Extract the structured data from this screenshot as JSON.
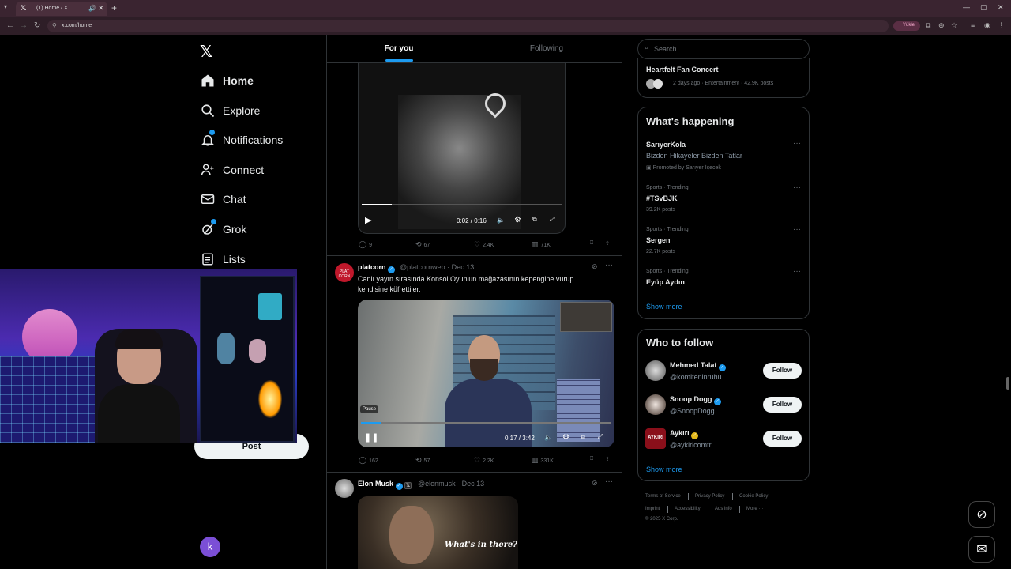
{
  "browser": {
    "tab_title": "(1) Home / X",
    "url": "x.com/home",
    "yukle": "Yükle"
  },
  "nav": {
    "home": "Home",
    "explore": "Explore",
    "notifications": "Notifications",
    "connect": "Connect",
    "chat": "Chat",
    "grok": "Grok",
    "lists": "Lists",
    "post": "Post",
    "account_initial": "k"
  },
  "tabs": {
    "for_you": "For you",
    "following": "Following"
  },
  "tweet1": {
    "video_time": "0:02 / 0:16",
    "video_progress": 0.15,
    "replies": "9",
    "reposts": "67",
    "likes": "2.4K",
    "views": "71K"
  },
  "tweet2": {
    "name": "platcorn",
    "handle": "@platcornweb",
    "date": "· Dec 13",
    "text": "Canlı yayın sırasında Konsol Oyun'un mağazasının kepengine vurup kendisine küfrettiler.",
    "pause_tip": "Pause",
    "video_time": "0:17 / 3:42",
    "video_progress": 0.08,
    "replies": "162",
    "reposts": "57",
    "likes": "2.2K",
    "views": "331K",
    "avatar_text": "PLAT CORN"
  },
  "tweet3": {
    "name": "Elon Musk",
    "handle": "@elonmusk",
    "date": "· Dec 13",
    "gif_caption": "What's in there?"
  },
  "right": {
    "search_placeholder": "Search",
    "top_event": {
      "title": "Heartfelt Fan Concert",
      "meta": "2 days ago · Entertainment · 42.9K posts"
    },
    "whats_happening": "What's happening",
    "promoted": {
      "title": "SarıyerKola",
      "subtitle": "Bizden Hikayeler Bizden Tatlar",
      "note": "Promoted by Sarıyer İçecek"
    },
    "trends": [
      {
        "context": "Sports · Trending",
        "name": "#TSvBJK",
        "posts": "39.2K posts"
      },
      {
        "context": "Sports · Trending",
        "name": "Sergen",
        "posts": "22.7K posts"
      },
      {
        "context": "Sports · Trending",
        "name": "Eyüp Aydın",
        "posts": ""
      }
    ],
    "show_more": "Show more",
    "who_to_follow": "Who to follow",
    "suggestions": [
      {
        "name": "Mehmed Talat",
        "handle": "@komiteninruhu",
        "follow": "Follow"
      },
      {
        "name": "Snoop Dogg",
        "handle": "@SnoopDogg",
        "follow": "Follow"
      },
      {
        "name": "Aykırı",
        "handle": "@aykiricomtr",
        "follow": "Follow"
      }
    ],
    "show_more_2": "Show more",
    "footer": {
      "terms": "Terms of Service",
      "privacy": "Privacy Policy",
      "cookie": "Cookie Policy",
      "imprint": "Imprint",
      "accessibility": "Accessibility",
      "ads": "Ads info",
      "more": "More ···",
      "copyright": "© 2025 X Corp."
    }
  },
  "colors": {
    "accent": "#1d9bf0",
    "background": "#000000",
    "border": "#2f3336"
  }
}
